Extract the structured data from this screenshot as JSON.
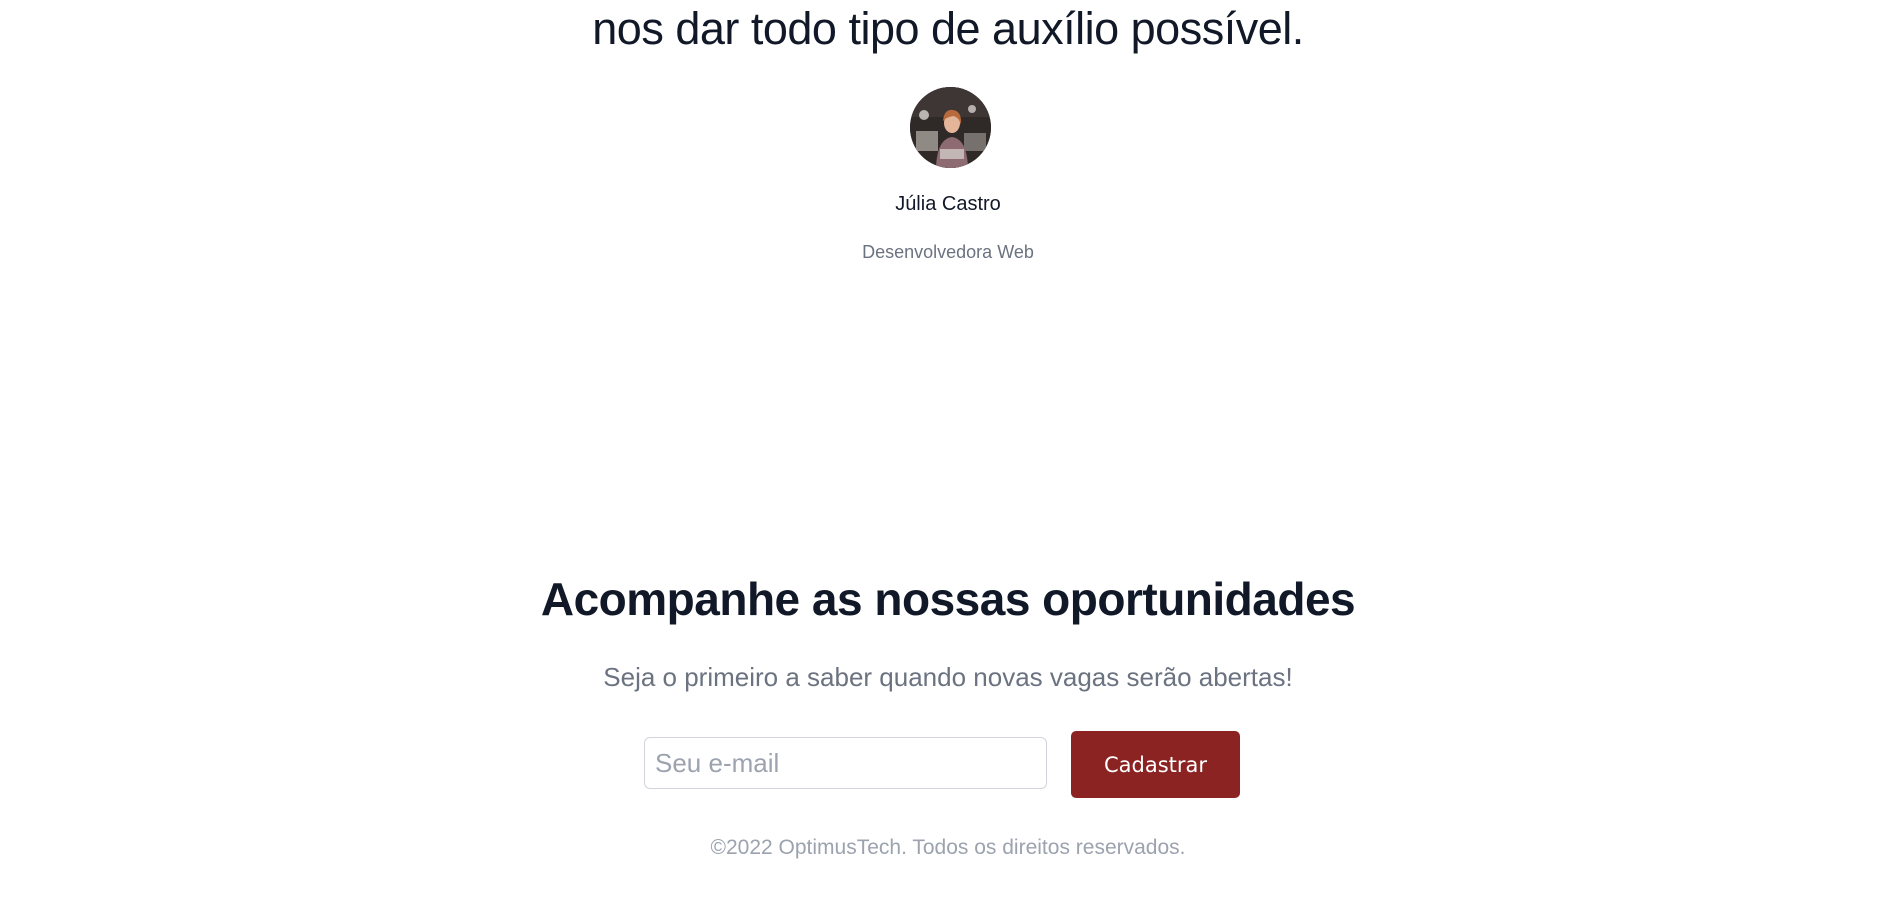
{
  "testimonial": {
    "quote_last_line": "nos dar todo tipo de auxílio possível.",
    "author_name": "Júlia Castro",
    "author_role": "Desenvolvedora Web",
    "avatar_icon": "person-photo"
  },
  "newsletter": {
    "title": "Acompanhe as nossas oportunidades",
    "subtitle": "Seja o primeiro a saber quando novas vagas serão abertas!",
    "email_placeholder": "Seu e-mail",
    "email_value": "",
    "submit_label": "Cadastrar"
  },
  "footer": {
    "copyright": "©2022 OptimusTech. Todos os direitos reservados."
  },
  "colors": {
    "accent": "#8b2323",
    "heading": "#111827",
    "muted": "#6b7280",
    "footer": "#9ca3af"
  }
}
